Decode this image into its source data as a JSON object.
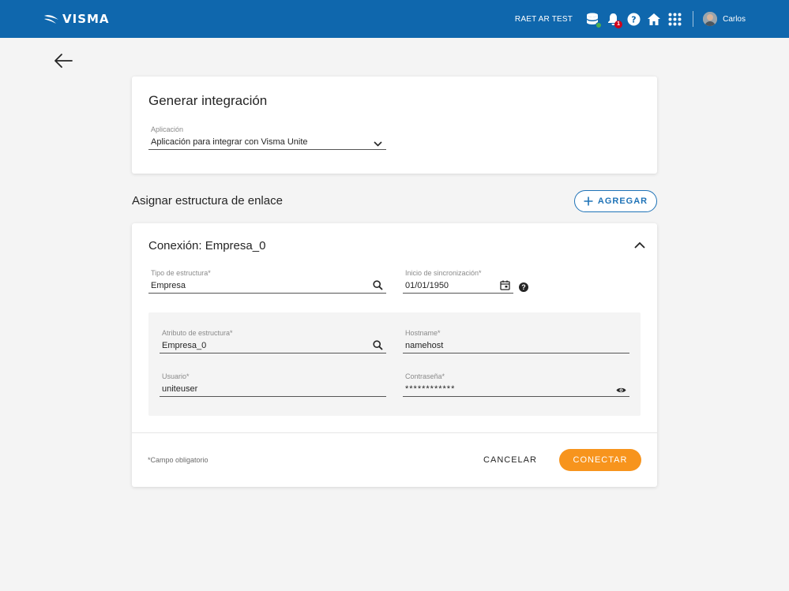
{
  "header": {
    "logo_text": "VISMA",
    "environment": "RAET AR TEST",
    "notification_count": "1",
    "user_name": "Carlos",
    "brand_color": "#0f67ad"
  },
  "form": {
    "title": "Generar integración",
    "application": {
      "label": "Aplicación",
      "value": "Aplicación para integrar con Visma Unite"
    }
  },
  "links": {
    "title": "Asignar estructura de enlace",
    "add_label": "AGREGAR"
  },
  "connection": {
    "title": "Conexión: Empresa_0",
    "structure_type": {
      "label": "Tipo de estructura*",
      "value": "Empresa"
    },
    "sync_start": {
      "label": "Inicio de sincronización*",
      "value": "01/01/1950"
    },
    "structure_attribute": {
      "label": "Atributo de estructura*",
      "value": "Empresa_0"
    },
    "hostname": {
      "label": "Hostname*",
      "value": "namehost"
    },
    "user": {
      "label": "Usuario*",
      "value": "uniteuser"
    },
    "password": {
      "label": "Contraseña*",
      "value": "************"
    },
    "required_note": "*Campo obligatorio",
    "cancel_label": "CANCELAR",
    "connect_label": "CONECTAR",
    "accent_color": "#f7941d"
  }
}
